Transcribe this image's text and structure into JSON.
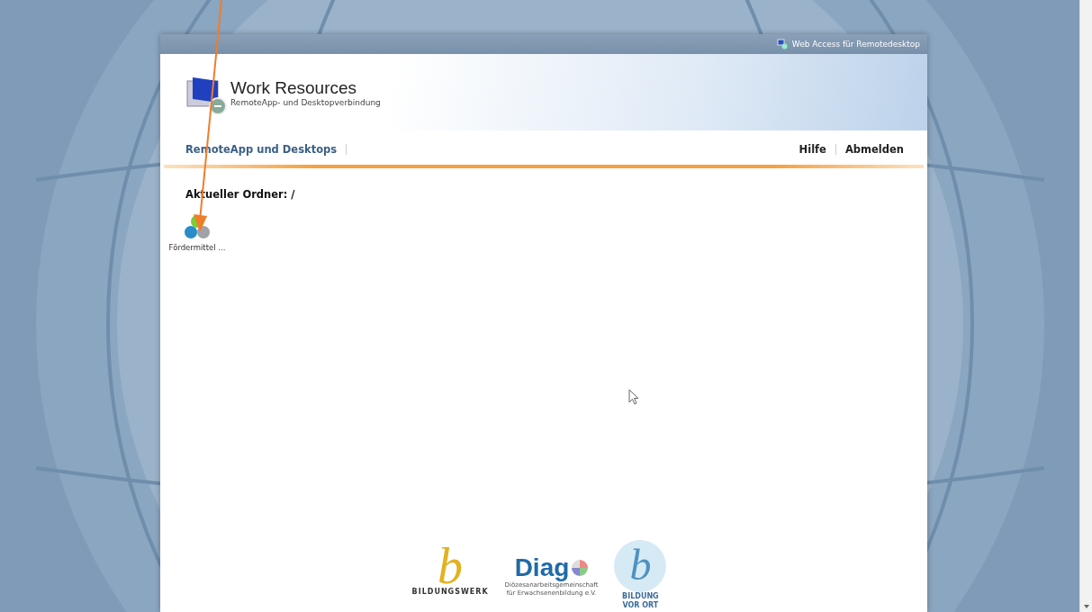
{
  "top_bar": {
    "title": "Web Access für Remotedesktop"
  },
  "banner": {
    "title": "Work Resources",
    "subtitle": "RemoteApp- und Desktopverbindung"
  },
  "nav": {
    "left": [
      {
        "label": "RemoteApp und Desktops",
        "selected": true
      }
    ],
    "right": [
      {
        "label": "Hilfe"
      },
      {
        "label": "Abmelden"
      }
    ]
  },
  "folder": {
    "label": "Aktueller Ordner: /"
  },
  "apps": [
    {
      "label": "Fördermittel ..."
    }
  ],
  "logos": [
    {
      "kind": "bildungswerk",
      "mark": "b",
      "name": "BILDUNGSWERK"
    },
    {
      "kind": "diag",
      "mark": "Diag",
      "lines": [
        "Diözesanarbeitsgemeinschaft",
        "für Erwachsenenbildung e.V."
      ]
    },
    {
      "kind": "vorort",
      "mark": "b",
      "lines": [
        "BILDUNG",
        "VOR ORT"
      ]
    }
  ]
}
